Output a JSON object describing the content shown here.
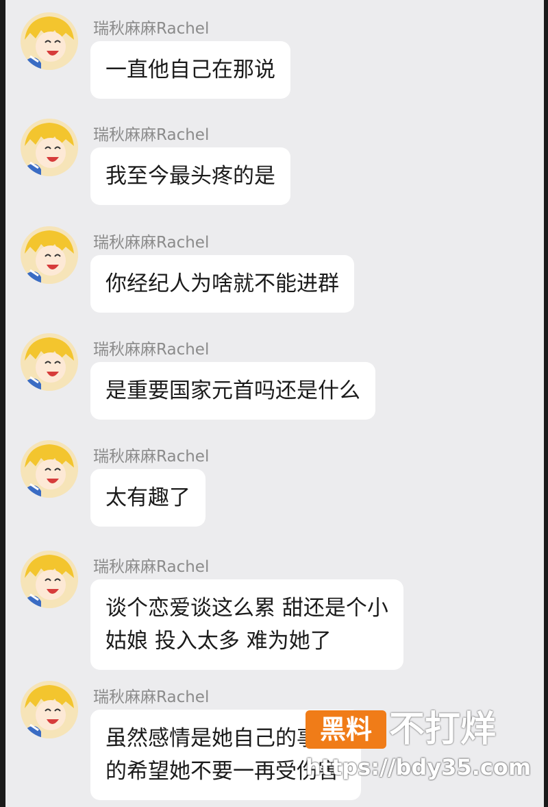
{
  "messages": [
    {
      "sender": "瑞秋麻麻Rachel",
      "text": "一直他自己在那说"
    },
    {
      "sender": "瑞秋麻麻Rachel",
      "text": "我至今最头疼的是"
    },
    {
      "sender": "瑞秋麻麻Rachel",
      "text": "你经纪人为啥就不能进群"
    },
    {
      "sender": "瑞秋麻麻Rachel",
      "text": "是重要国家元首吗还是什么"
    },
    {
      "sender": "瑞秋麻麻Rachel",
      "text": "太有趣了"
    },
    {
      "sender": "瑞秋麻麻Rachel",
      "text": "谈个恋爱谈这么累 甜还是个小\n姑娘 投入太多 难为她了"
    },
    {
      "sender": "瑞秋麻麻Rachel",
      "text": "虽然感情是她自己的事 真\n的希望她不要一再受伤害"
    }
  ],
  "watermark": {
    "badge": "黑料",
    "title": "不打烊",
    "url": "https://bdy35.com"
  },
  "colors": {
    "background": "#ececee",
    "bubble": "#ffffff",
    "accent": "#f07c18"
  }
}
